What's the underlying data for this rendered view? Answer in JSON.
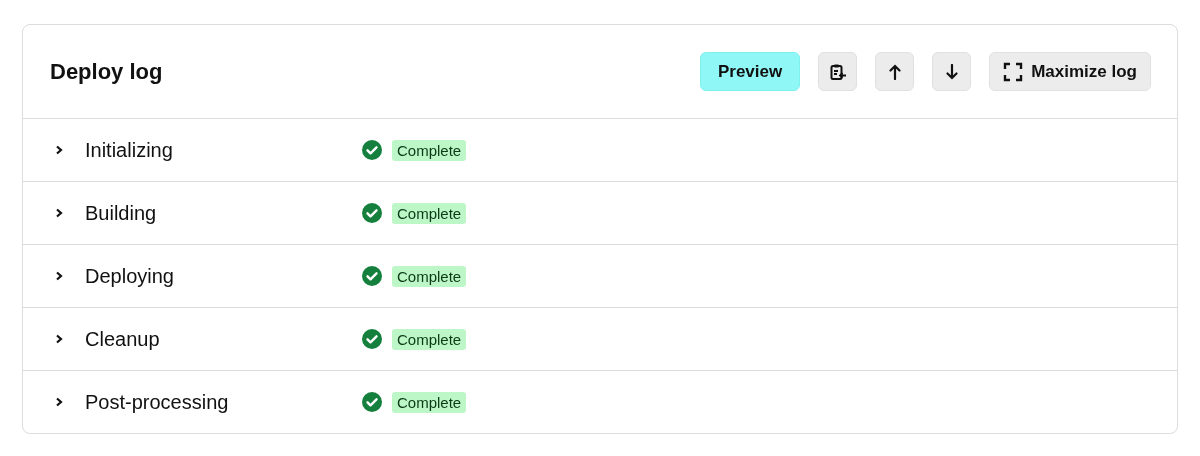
{
  "title": "Deploy log",
  "toolbar": {
    "preview": "Preview",
    "maximize": "Maximize log"
  },
  "steps": [
    {
      "name": "Initializing",
      "expanded": false,
      "status": {
        "kind": "complete",
        "label": "Complete"
      }
    },
    {
      "name": "Building",
      "expanded": false,
      "status": {
        "kind": "complete",
        "label": "Complete"
      }
    },
    {
      "name": "Deploying",
      "expanded": false,
      "status": {
        "kind": "complete",
        "label": "Complete"
      }
    },
    {
      "name": "Cleanup",
      "expanded": false,
      "status": {
        "kind": "complete",
        "label": "Complete"
      }
    },
    {
      "name": "Post-processing",
      "expanded": false,
      "status": {
        "kind": "complete",
        "label": "Complete"
      }
    }
  ]
}
